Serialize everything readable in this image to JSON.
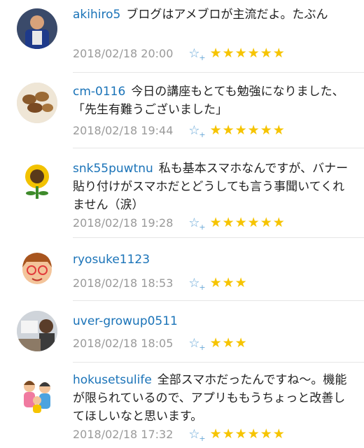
{
  "comments": [
    {
      "user": "akihiro5",
      "text": "ブログはアメブロが主流だよ。たぶん",
      "date": "2018/02/18 20:00",
      "stars": "★★★★★★"
    },
    {
      "user": "cm-0116",
      "text": "今日の講座もとても勉強になりました、「先生有難うございました」",
      "date": "2018/02/18 19:44",
      "stars": "★★★★★★"
    },
    {
      "user": "snk55puwtnu",
      "text": "私も基本スマホなんですが、バナー貼り付けがスマホだとどうしても言う事聞いてくれません（涙）",
      "date": "2018/02/18 19:28",
      "stars": "★★★★★★"
    },
    {
      "user": "ryosuke1123",
      "text": "",
      "date": "2018/02/18 18:53",
      "stars": "★★★"
    },
    {
      "user": "uver-growup0511",
      "text": "",
      "date": "2018/02/18 18:05",
      "stars": "★★★"
    },
    {
      "user": "hokusetsulife",
      "text": "全部スマホだったんですね〜。機能が限られているので、アプリももうちょっと改善してほしいなと思います。",
      "date": "2018/02/18 17:32",
      "stars": "★★★★★★"
    }
  ],
  "icons": {
    "star_add": "star-add-icon",
    "star": "star-icon"
  }
}
